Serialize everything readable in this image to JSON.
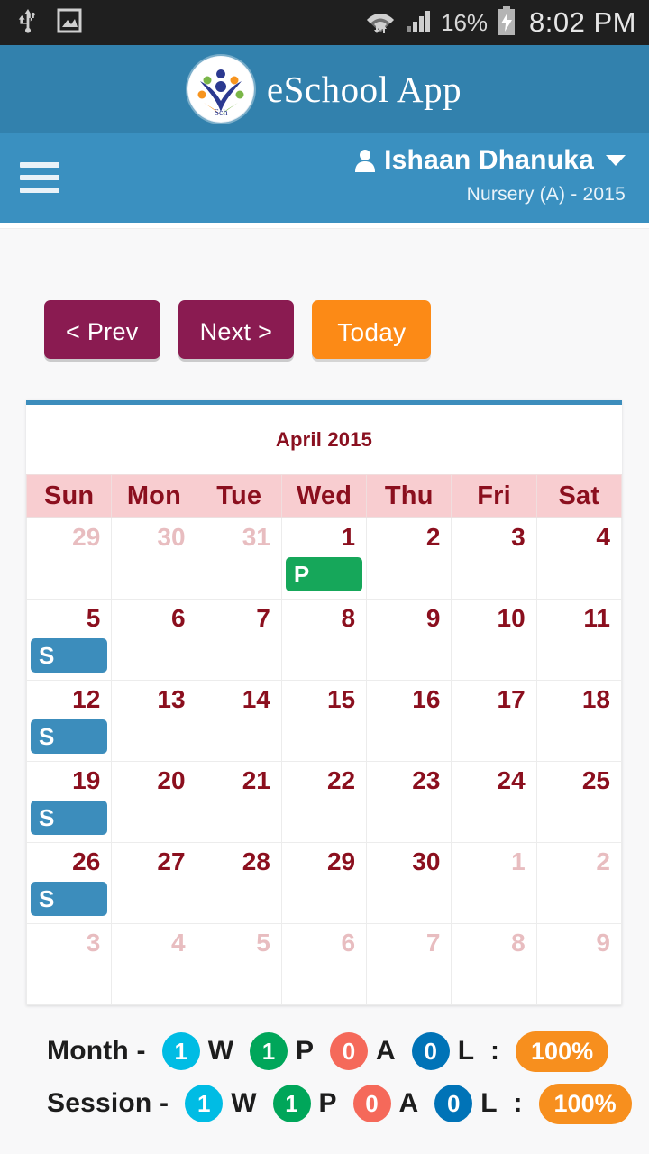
{
  "statusbar": {
    "icons_left": [
      "usb-icon",
      "screenshot-image-icon"
    ],
    "wifi_icon": "wifi-icon",
    "signal_icon": "cellular-signal-icon",
    "battery_percent": "16%",
    "battery_icon": "battery-charging-icon",
    "clock": "8:02 PM"
  },
  "brand": {
    "logo_name": "eschool-logo",
    "title": "eSchool App"
  },
  "userbar": {
    "menu_icon": "hamburger-menu-icon",
    "avatar_icon": "user-avatar-icon",
    "user_name": "Ishaan Dhanuka",
    "caret_icon": "chevron-down-icon",
    "class_line": "Nursery (A) - 2015"
  },
  "toolbar": {
    "prev_label": "< Prev",
    "next_label": "Next >",
    "today_label": "Today"
  },
  "calendar": {
    "title": "April 2015",
    "weekdays": [
      "Sun",
      "Mon",
      "Tue",
      "Wed",
      "Thu",
      "Fri",
      "Sat"
    ],
    "weeks": [
      [
        {
          "day": "29",
          "other": true,
          "event": null
        },
        {
          "day": "30",
          "other": true,
          "event": null
        },
        {
          "day": "31",
          "other": true,
          "event": null
        },
        {
          "day": "1",
          "other": false,
          "event": "P"
        },
        {
          "day": "2",
          "other": false,
          "event": null
        },
        {
          "day": "3",
          "other": false,
          "event": null
        },
        {
          "day": "4",
          "other": false,
          "event": null
        }
      ],
      [
        {
          "day": "5",
          "other": false,
          "event": "S"
        },
        {
          "day": "6",
          "other": false,
          "event": null
        },
        {
          "day": "7",
          "other": false,
          "event": null
        },
        {
          "day": "8",
          "other": false,
          "event": null
        },
        {
          "day": "9",
          "other": false,
          "event": null
        },
        {
          "day": "10",
          "other": false,
          "event": null
        },
        {
          "day": "11",
          "other": false,
          "event": null
        }
      ],
      [
        {
          "day": "12",
          "other": false,
          "event": "S"
        },
        {
          "day": "13",
          "other": false,
          "event": null
        },
        {
          "day": "14",
          "other": false,
          "event": null
        },
        {
          "day": "15",
          "other": false,
          "event": null
        },
        {
          "day": "16",
          "other": false,
          "event": null
        },
        {
          "day": "17",
          "other": false,
          "event": null
        },
        {
          "day": "18",
          "other": false,
          "event": null
        }
      ],
      [
        {
          "day": "19",
          "other": false,
          "event": "S"
        },
        {
          "day": "20",
          "other": false,
          "event": null
        },
        {
          "day": "21",
          "other": false,
          "event": null
        },
        {
          "day": "22",
          "other": false,
          "event": null
        },
        {
          "day": "23",
          "other": false,
          "event": null
        },
        {
          "day": "24",
          "other": false,
          "event": null
        },
        {
          "day": "25",
          "other": false,
          "event": null
        }
      ],
      [
        {
          "day": "26",
          "other": false,
          "event": "S"
        },
        {
          "day": "27",
          "other": false,
          "event": null
        },
        {
          "day": "28",
          "other": false,
          "event": null
        },
        {
          "day": "29",
          "other": false,
          "event": null
        },
        {
          "day": "30",
          "other": false,
          "event": null
        },
        {
          "day": "1",
          "other": true,
          "event": null
        },
        {
          "day": "2",
          "other": true,
          "event": null
        }
      ],
      [
        {
          "day": "3",
          "other": true,
          "event": null
        },
        {
          "day": "4",
          "other": true,
          "event": null
        },
        {
          "day": "5",
          "other": true,
          "event": null
        },
        {
          "day": "6",
          "other": true,
          "event": null
        },
        {
          "day": "7",
          "other": true,
          "event": null
        },
        {
          "day": "8",
          "other": true,
          "event": null
        },
        {
          "day": "9",
          "other": true,
          "event": null
        }
      ]
    ]
  },
  "summary": {
    "rows": [
      {
        "label": "Month -",
        "counts": [
          {
            "value": "1",
            "code": "W",
            "color": "#00bce4"
          },
          {
            "value": "1",
            "code": "P",
            "color": "#00a65a"
          },
          {
            "value": "0",
            "code": "A",
            "color": "#f5695a"
          },
          {
            "value": "0",
            "code": "L",
            "color": "#0073b7"
          }
        ],
        "separator": ":",
        "percent": "100%"
      },
      {
        "label": "Session -",
        "counts": [
          {
            "value": "1",
            "code": "W",
            "color": "#00bce4"
          },
          {
            "value": "1",
            "code": "P",
            "color": "#00a65a"
          },
          {
            "value": "0",
            "code": "A",
            "color": "#f5695a"
          },
          {
            "value": "0",
            "code": "L",
            "color": "#0073b7"
          }
        ],
        "separator": ":",
        "percent": "100%"
      }
    ]
  },
  "colors": {
    "brand_blue": "#3281ad",
    "userbar_blue": "#3a90c0",
    "nav_button": "#8a1b51",
    "today_button": "#fc8a16",
    "calendar_top_border": "#3c8dbc",
    "weekday_header_bg": "#f8cdd0",
    "day_text": "#8b0f1e",
    "present_badge": "#16a75a",
    "sunday_badge": "#3c8dbc",
    "percent_pill": "#f78f1e"
  }
}
